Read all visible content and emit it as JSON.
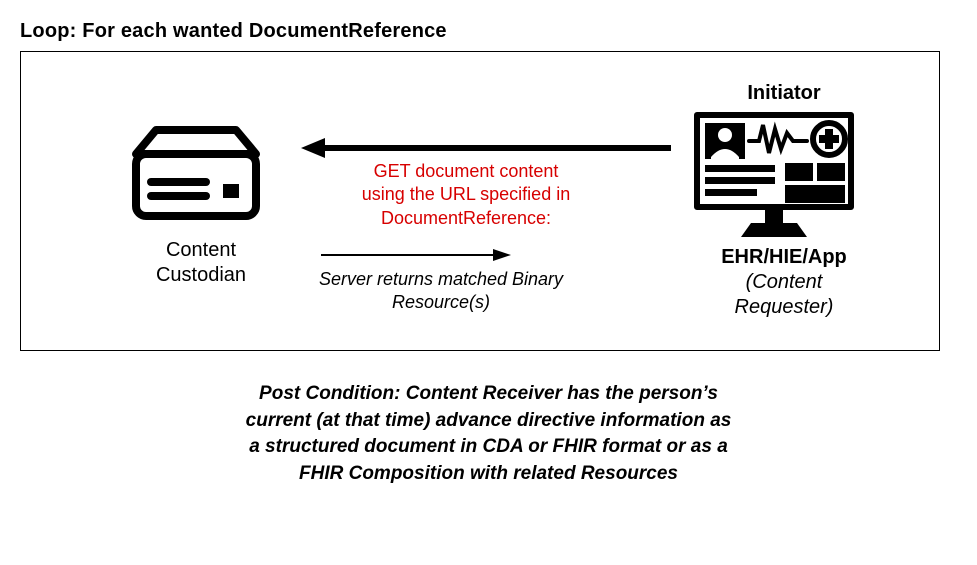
{
  "title": "Loop:  For each wanted DocumentReference",
  "left_node": {
    "label_line1": "Content",
    "label_line2": "Custodian"
  },
  "right_node": {
    "initiator": "Initiator",
    "label_bold": "EHR/HIE/App",
    "label_ital_line1": "(Content",
    "label_ital_line2": "Requester)"
  },
  "request": {
    "line1": "GET document content",
    "line2": "using the URL specified in",
    "line3": "DocumentReference:"
  },
  "response": {
    "line1": "Server returns matched Binary",
    "line2": "Resource(s)"
  },
  "post_condition": "Post Condition:  Content Receiver has the person’s current (at that time) advance directive information as a structured document in CDA or FHIR format or as a FHIR Composition with related Resources"
}
